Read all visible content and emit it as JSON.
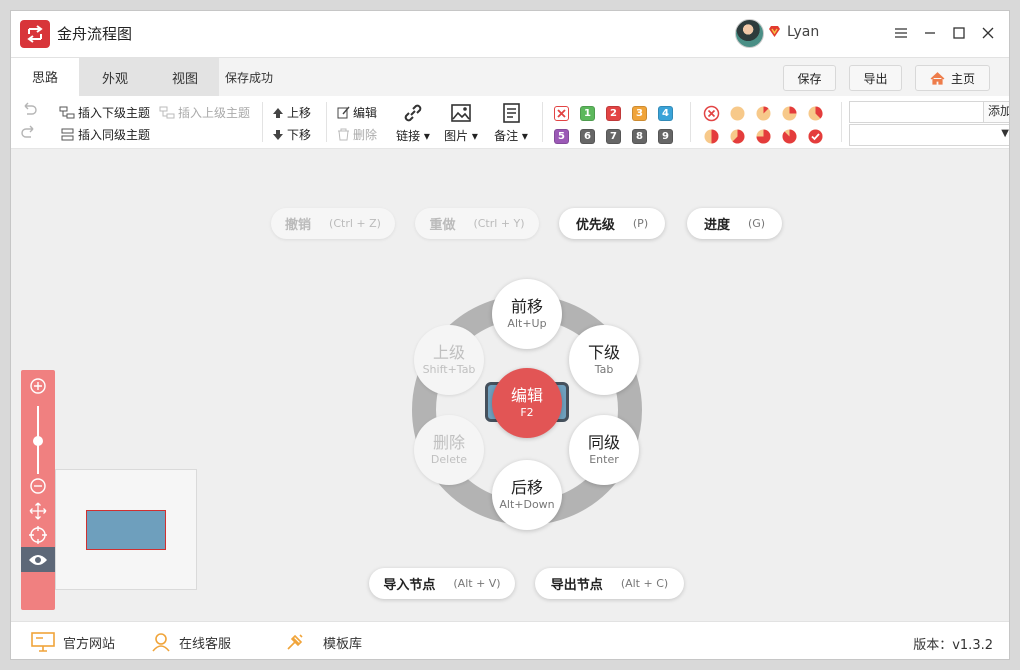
{
  "app": {
    "title": "金舟流程图"
  },
  "user": {
    "name": "Lyan"
  },
  "tabs": [
    {
      "label": "思路"
    },
    {
      "label": "外观"
    },
    {
      "label": "视图"
    }
  ],
  "save_status": "保存成功",
  "top_buttons": {
    "save": "保存",
    "export": "导出",
    "home": "主页"
  },
  "toolbar": {
    "insert_child": "插入下级主题",
    "insert_parent": "插入上级主题",
    "insert_sibling": "插入同级主题",
    "move_up": "上移",
    "move_down": "下移",
    "edit": "编辑",
    "delete": "删除",
    "link": "链接",
    "image": "图片",
    "note": "备注",
    "priorities": [
      "1",
      "2",
      "3",
      "4",
      "5",
      "6",
      "7",
      "8",
      "9"
    ],
    "priority_colors": [
      "#5cb85c",
      "#e24444",
      "#f0a43a",
      "#3aa3d8",
      "#9b59b6",
      "#666666",
      "#666666",
      "#666666",
      "#666666"
    ],
    "progress_levels": [
      0,
      0.125,
      0.25,
      0.375,
      0.5,
      0.625,
      0.75,
      0.875,
      1
    ],
    "tag_add": "添加"
  },
  "accent": "#e25555",
  "canvas": {
    "undo": {
      "label": "撤销",
      "key": "(Ctrl + Z)"
    },
    "redo": {
      "label": "重做",
      "key": "(Ctrl + Y)"
    },
    "priority": {
      "label": "优先级",
      "key": "(P)"
    },
    "progress": {
      "label": "进度",
      "key": "(G)"
    },
    "radial": {
      "center": {
        "label": "编辑",
        "key": "F2"
      },
      "up": {
        "label": "前移",
        "key": "Alt+Up"
      },
      "child": {
        "label": "下级",
        "key": "Tab"
      },
      "sibling": {
        "label": "同级",
        "key": "Enter"
      },
      "down": {
        "label": "后移",
        "key": "Alt+Down"
      },
      "delete": {
        "label": "删除",
        "key": "Delete"
      },
      "parent": {
        "label": "上级",
        "key": "Shift+Tab"
      }
    },
    "import_node": {
      "label": "导入节点",
      "key": "(Alt + V)"
    },
    "export_node": {
      "label": "导出节点",
      "key": "(Alt + C)"
    }
  },
  "footer": {
    "website": "官方网站",
    "support": "在线客服",
    "templates": "模板库",
    "version": "版本：v1.3.2"
  }
}
